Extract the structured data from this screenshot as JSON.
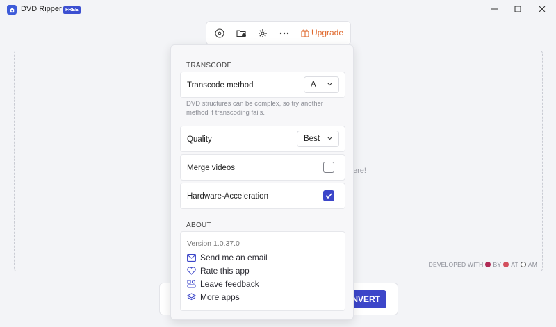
{
  "app": {
    "title": "DVD Ripper",
    "badge": "FREE"
  },
  "toolbar": {
    "upgrade_label": "Upgrade"
  },
  "drop_area": {
    "hint_visible": "ere!"
  },
  "footer": {
    "developed_with": "DEVELOPED WITH",
    "by": "BY",
    "at": "AT",
    "am": "AM"
  },
  "convert": {
    "label": "CONVERT",
    "visible": "NVERT"
  },
  "settings": {
    "transcode_header": "TRANSCODE",
    "transcode_method_label": "Transcode method",
    "transcode_method_value": "A",
    "transcode_hint": "DVD structures can be complex, so try another method if transcoding fails.",
    "quality_label": "Quality",
    "quality_value": "Best",
    "merge_label": "Merge videos",
    "merge_checked": false,
    "hw_label": "Hardware-Acceleration",
    "hw_checked": true,
    "about_header": "ABOUT",
    "version": "Version 1.0.37.0",
    "links": [
      "Send me an email",
      "Rate this app",
      "Leave feedback",
      "More apps"
    ]
  },
  "colors": {
    "accent": "#3c46c9",
    "upgrade": "#e0692d"
  }
}
